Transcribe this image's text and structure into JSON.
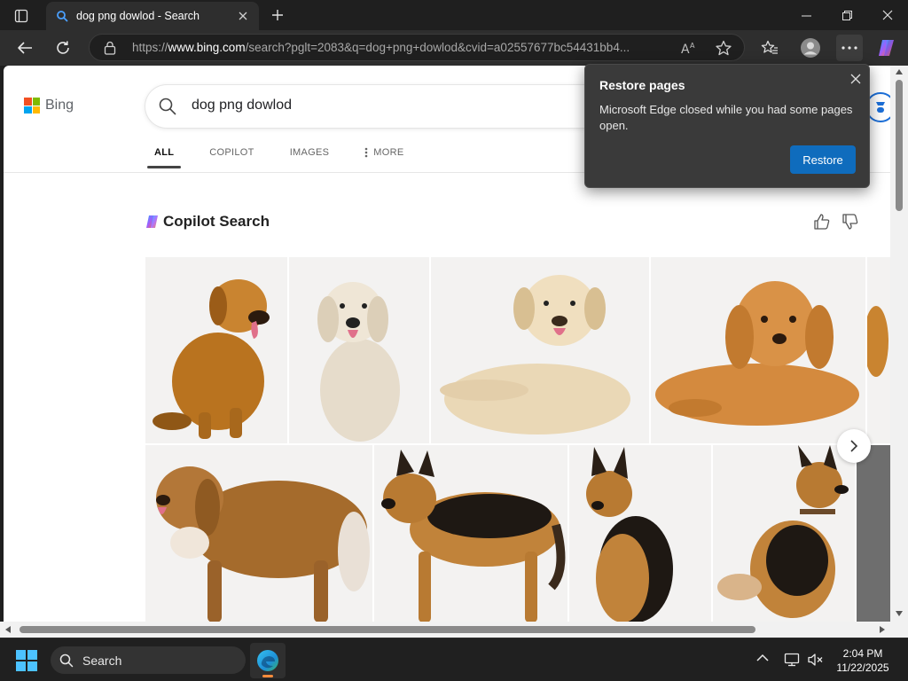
{
  "browser": {
    "tab_title": "dog png dowlod - Search",
    "url_scheme": "https://",
    "url_host": "www.bing.com",
    "url_path": "/search?pglt=2083&q=dog+png+dowlod&cvid=a02557677bc54431bb4..."
  },
  "bing": {
    "logo_text": "Bing",
    "query": "dog png dowlod",
    "tabs": [
      {
        "label": "ALL",
        "active": true
      },
      {
        "label": "COPILOT",
        "active": false
      },
      {
        "label": "IMAGES",
        "active": false
      },
      {
        "label": "MORE",
        "active": false
      }
    ],
    "copilot_title": "Copilot Search"
  },
  "restore_popup": {
    "title": "Restore pages",
    "message": "Microsoft Edge closed while you had some pages open.",
    "button": "Restore"
  },
  "taskbar": {
    "search_label": "Search",
    "time": "2:04 PM",
    "date": "11/22/2025"
  },
  "colors": {
    "accent_blue": "#0f6cbd",
    "edge_indicator": "#ff8c3b",
    "ms_red": "#f25022",
    "ms_green": "#7fba00",
    "ms_blue": "#00a4ef",
    "ms_yellow": "#ffb900"
  }
}
